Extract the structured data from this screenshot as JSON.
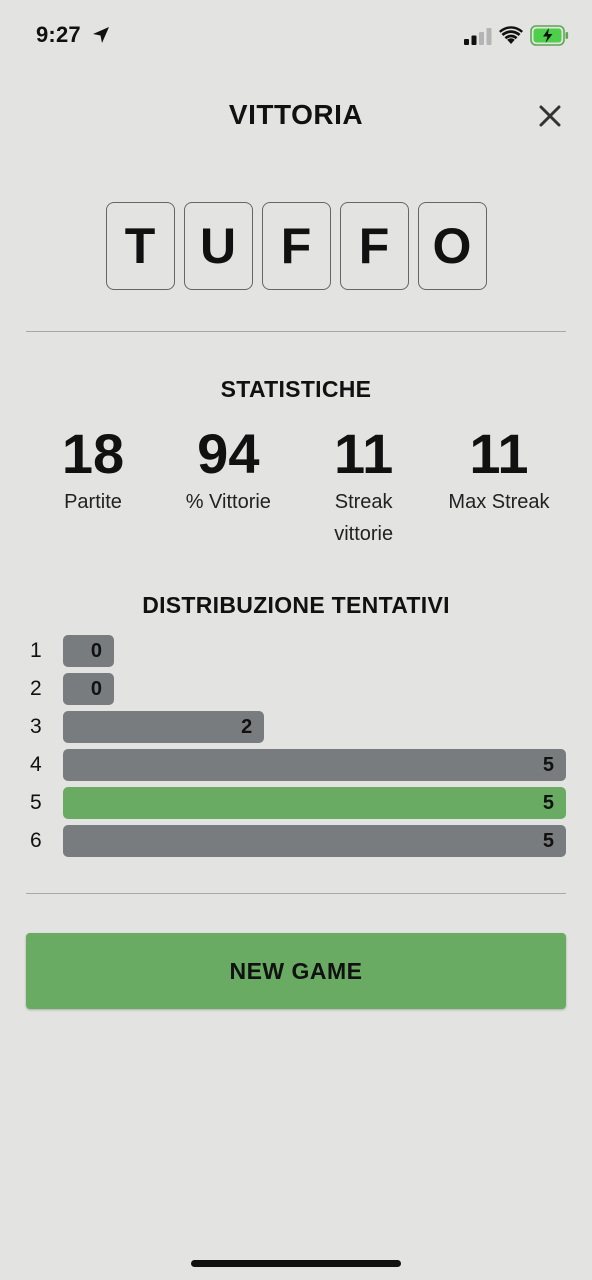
{
  "status_bar": {
    "time": "9:27",
    "icons": [
      "location-arrow-icon",
      "signal-icon",
      "wifi-icon",
      "battery-charging-icon"
    ]
  },
  "header": {
    "title": "VITTORIA",
    "close_icon": "close-icon"
  },
  "word": {
    "letters": [
      "T",
      "U",
      "F",
      "F",
      "O"
    ]
  },
  "stats": {
    "title": "STATISTICHE",
    "items": [
      {
        "value": "18",
        "label": "Partite"
      },
      {
        "value": "94",
        "label": "% Vittorie"
      },
      {
        "value": "11",
        "label": "Streak vittorie"
      },
      {
        "value": "11",
        "label": "Max Streak"
      }
    ]
  },
  "distribution": {
    "title": "DISTRIBUZIONE TENTATIVI",
    "rows": [
      {
        "guess": "1",
        "count": 0,
        "highlight": false
      },
      {
        "guess": "2",
        "count": 0,
        "highlight": false
      },
      {
        "guess": "3",
        "count": 2,
        "highlight": false
      },
      {
        "guess": "4",
        "count": 5,
        "highlight": false
      },
      {
        "guess": "5",
        "count": 5,
        "highlight": true
      },
      {
        "guess": "6",
        "count": 5,
        "highlight": false
      }
    ],
    "max": 5
  },
  "new_game_label": "NEW GAME",
  "colors": {
    "background": "#e3e3e1",
    "bar_default": "#797c7e",
    "bar_highlight": "#6aab64",
    "button": "#6aab64"
  }
}
